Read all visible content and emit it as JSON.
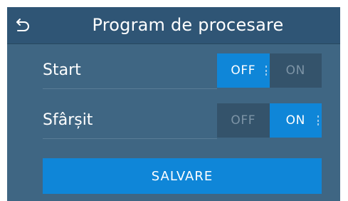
{
  "header": {
    "back_icon": "back-arrow-icon",
    "title": "Program de procesare"
  },
  "settings": [
    {
      "label": "Start",
      "off_label": "OFF",
      "on_label": "ON",
      "value": "OFF"
    },
    {
      "label": "Sfârșit",
      "off_label": "OFF",
      "on_label": "ON",
      "value": "ON"
    }
  ],
  "actions": {
    "save_label": "SALVARE"
  },
  "colors": {
    "background": "#3f6683",
    "header": "#2f5575",
    "accent": "#0f86d8",
    "toggle_inactive": "#34536b"
  }
}
